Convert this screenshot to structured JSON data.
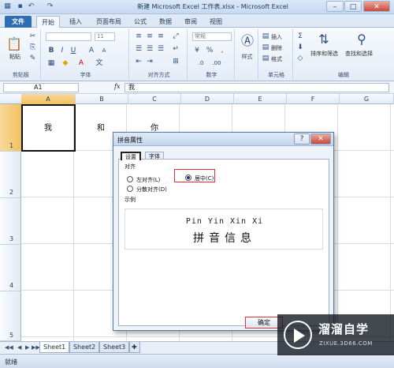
{
  "window": {
    "title": "新建 Microsoft Excel 工作表.xlsx - Microsoft Excel"
  },
  "ribbon": {
    "tabs": [
      "文件",
      "开始",
      "插入",
      "页面布局",
      "公式",
      "数据",
      "审阅",
      "视图"
    ],
    "groups": {
      "clipboard": {
        "label": "剪贴板",
        "paste": "粘贴"
      },
      "font": {
        "label": "字体",
        "size": "11"
      },
      "alignment": {
        "label": "对齐方式"
      },
      "number": {
        "label": "数字",
        "format": "常规",
        "percent": "%"
      },
      "styles": {
        "label": "样式"
      },
      "cells": {
        "label": "单元格",
        "insert": "插入",
        "delete": "删除",
        "format": "格式"
      },
      "editing": {
        "label": "编辑",
        "sort_filter": "排序和筛选",
        "find_select": "查找和选择"
      }
    }
  },
  "formula_bar": {
    "name_box": "A1",
    "fx": "fx",
    "content": "我"
  },
  "grid": {
    "columns": [
      "A",
      "B",
      "C",
      "D",
      "E",
      "F",
      "G"
    ],
    "rows": [
      "1",
      "2",
      "3",
      "4",
      "5"
    ],
    "cells": {
      "A1": "我",
      "B1": "和",
      "C1": "你"
    }
  },
  "sheets": {
    "tabs": [
      "Sheet1",
      "Sheet2",
      "Sheet3"
    ],
    "active": "Sheet1"
  },
  "status": {
    "text": "就绪"
  },
  "dialog": {
    "title": "拼音属性",
    "help": "?",
    "close": "✕",
    "tabs": [
      "设置",
      "字体"
    ],
    "section_align": "对齐",
    "options": {
      "left": "左对齐(L)",
      "distributed": "分散对齐(D)",
      "center": "居中(C)"
    },
    "selected": "center",
    "section_example": "示例",
    "preview_pinyin": "Pin Yin Xin Xi",
    "preview_hanzi": "拼音信息",
    "ok": "确定"
  },
  "watermark": {
    "title": "溜溜自学",
    "url": "ZIXUE.3D66.COM"
  }
}
